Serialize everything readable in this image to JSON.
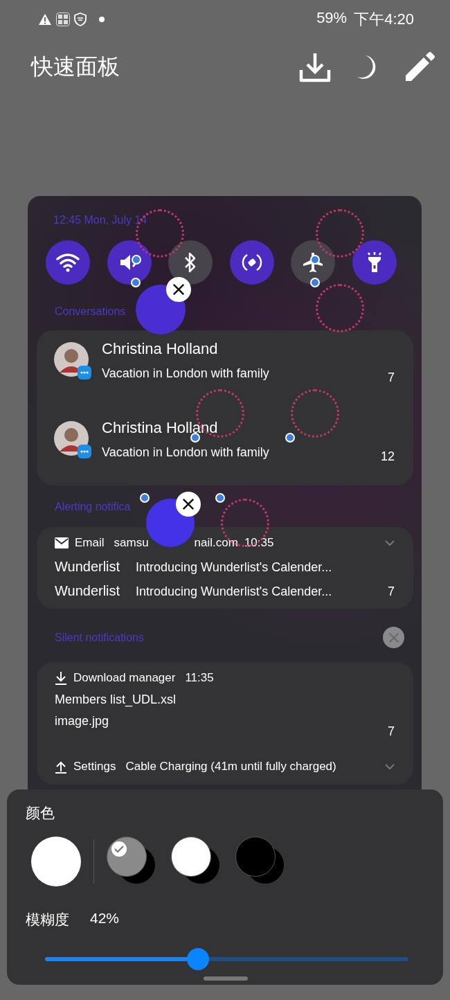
{
  "status_bar": {
    "battery": "59%",
    "time": "下午4:20"
  },
  "header": {
    "title": "快速面板"
  },
  "preview": {
    "date": "12:45 Mon, July 14",
    "tiles": [
      {
        "kind": "wifi",
        "on": true
      },
      {
        "kind": "sound",
        "on": true
      },
      {
        "kind": "bluetooth",
        "on": false
      },
      {
        "kind": "rotate",
        "on": true
      },
      {
        "kind": "airplane",
        "on": false
      },
      {
        "kind": "flashlight",
        "on": true
      }
    ],
    "conversations_label": "Conversations",
    "conversations": [
      {
        "name": "Christina Holland",
        "message": "Vacation in London with family",
        "count": "7"
      },
      {
        "name": "Christina Holland",
        "message": "Vacation in London with family",
        "count": "12"
      }
    ],
    "alerting_label": "Alerting notifica",
    "alerting": {
      "app": "Email",
      "sender_parts": [
        "samsu",
        "nail.com"
      ],
      "time": "10:35",
      "rows": [
        {
          "title": "Wunderlist",
          "text": "Introducing Wunderlist's Calender..."
        },
        {
          "title": "Wunderlist",
          "text": "Introducing Wunderlist's Calender..."
        }
      ],
      "count": "7"
    },
    "silent_label": "Silent notifications",
    "silent": {
      "app": "Download manager",
      "time": "11:35",
      "files": [
        "Members list_UDL.xsl",
        "image.jpg"
      ],
      "count": "7",
      "footer": {
        "app": "Settings",
        "text": "Cable Charging (41m until fully charged)"
      }
    }
  },
  "panel": {
    "color_label": "颜色",
    "swatches": [
      {
        "color": "#8a8a8a",
        "selected": true
      },
      {
        "color": "#ffffff",
        "selected": false
      },
      {
        "color": "#000000",
        "selected": false
      }
    ],
    "blur_label": "模糊度",
    "blur_value": "42%",
    "blur": {
      "level": 0.42
    }
  }
}
